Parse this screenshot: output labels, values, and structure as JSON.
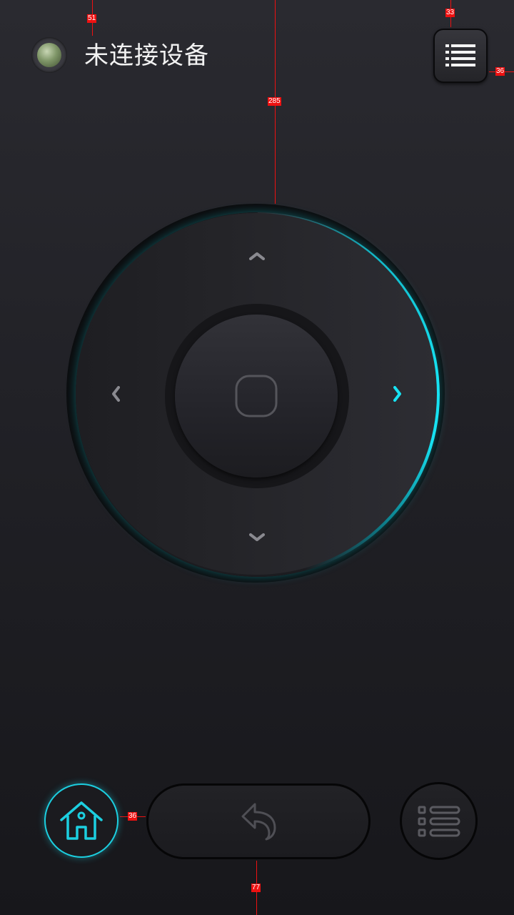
{
  "header": {
    "title": "未连接设备",
    "status": "disconnected"
  },
  "annotations": {
    "top_left": "51",
    "top_right": "33",
    "right_edge": "36",
    "dpad_top": "285",
    "home_gap": "36",
    "bottom": "77"
  },
  "icons": {
    "menu": "menu-list-icon",
    "up": "chevron-up-icon",
    "down": "chevron-down-icon",
    "left": "chevron-left-icon",
    "right": "chevron-right-icon",
    "ok": "rounded-square-icon",
    "home": "home-icon",
    "back": "back-arrow-icon",
    "list": "list-icon"
  },
  "colors": {
    "accent": "#17e2f2",
    "background": "#23232a"
  }
}
